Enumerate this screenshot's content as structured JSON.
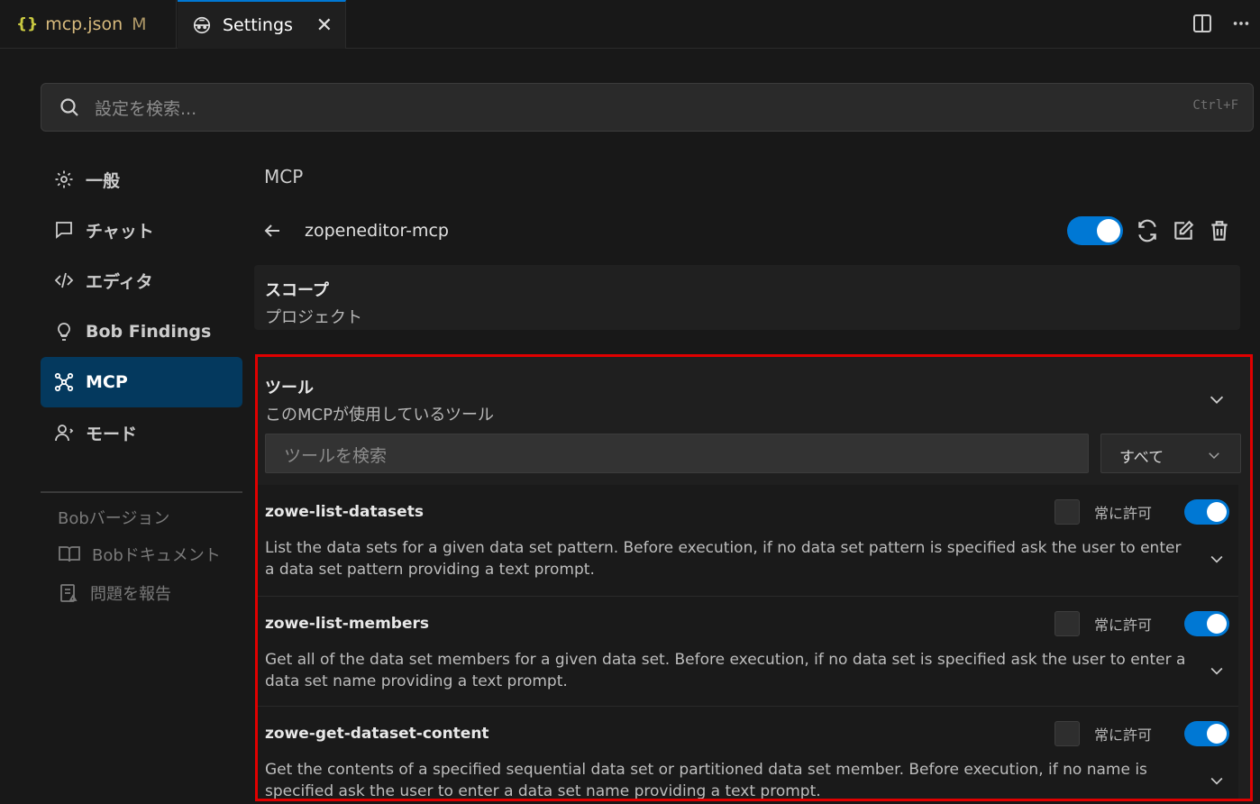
{
  "tabs": [
    {
      "icon": "braces-icon",
      "label": "mcp.json",
      "modified": "M"
    },
    {
      "icon": "robot-icon",
      "label": "Settings",
      "close": "✕"
    }
  ],
  "search": {
    "placeholder": "設定を検索...",
    "shortcut": "Ctrl+F"
  },
  "sidebar": {
    "items": [
      {
        "icon": "gear-icon",
        "label": "一般"
      },
      {
        "icon": "chat-icon",
        "label": "チャット"
      },
      {
        "icon": "code-icon",
        "label": "エディタ"
      },
      {
        "icon": "lightbulb-icon",
        "label": "Bob Findings"
      },
      {
        "icon": "mcp-icon",
        "label": "MCP",
        "active": true
      },
      {
        "icon": "person-icon",
        "label": "モード"
      }
    ],
    "version_label": "Bobバージョン",
    "links": [
      {
        "icon": "book-icon",
        "label": "Bobドキュメント"
      },
      {
        "icon": "report-icon",
        "label": "問題を報告"
      }
    ]
  },
  "main": {
    "section_title": "MCP",
    "server_name": "zopeneditor-mcp",
    "server_enabled": true,
    "scope": {
      "title": "スコープ",
      "value": "プロジェクト"
    },
    "tools": {
      "title": "ツール",
      "subtitle": "このMCPが使用しているツール",
      "search_placeholder": "ツールを検索",
      "filter_value": "すべて",
      "always_allow_label": "常に許可",
      "items": [
        {
          "name": "zowe-list-datasets",
          "always_allow": false,
          "enabled": true,
          "description": "List the data sets for a given data set pattern. Before execution, if no data set pattern is specified ask the user to enter a data set pattern providing a text prompt."
        },
        {
          "name": "zowe-list-members",
          "always_allow": false,
          "enabled": true,
          "description": "Get all of the data set members for a given data set. Before execution, if no data set is specified ask the user to enter a data set name providing a text prompt."
        },
        {
          "name": "zowe-get-dataset-content",
          "always_allow": false,
          "enabled": true,
          "description": "Get the contents of a specified sequential data set or partitioned data set member. Before execution, if no name is specified ask the user to enter a data set name providing a text prompt."
        }
      ]
    }
  },
  "colors": {
    "accent": "#0078d4",
    "highlight_border": "#e00000",
    "active_nav": "#04395e"
  }
}
